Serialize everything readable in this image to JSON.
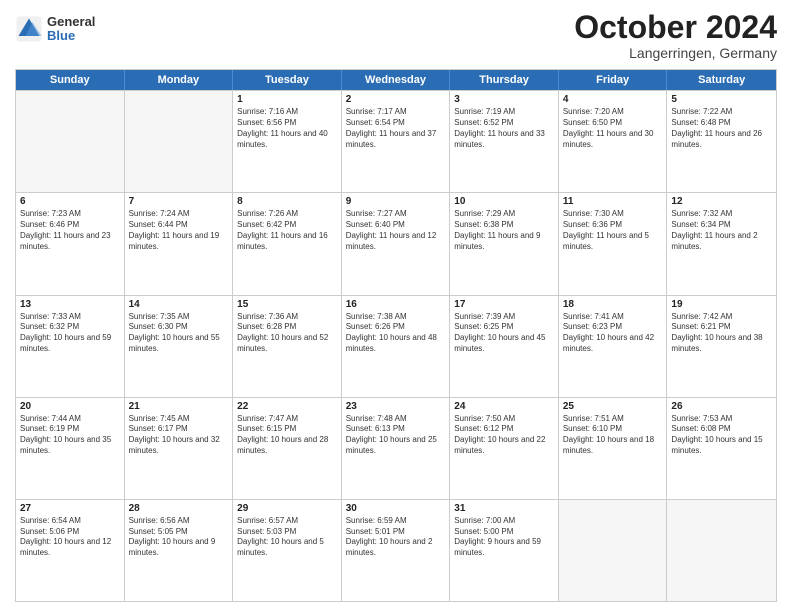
{
  "header": {
    "logo": {
      "general": "General",
      "blue": "Blue"
    },
    "title": "October 2024",
    "location": "Langerringen, Germany"
  },
  "weekdays": [
    "Sunday",
    "Monday",
    "Tuesday",
    "Wednesday",
    "Thursday",
    "Friday",
    "Saturday"
  ],
  "rows": [
    [
      {
        "day": "",
        "info": "",
        "empty": true
      },
      {
        "day": "",
        "info": "",
        "empty": true
      },
      {
        "day": "1",
        "info": "Sunrise: 7:16 AM\nSunset: 6:56 PM\nDaylight: 11 hours and 40 minutes."
      },
      {
        "day": "2",
        "info": "Sunrise: 7:17 AM\nSunset: 6:54 PM\nDaylight: 11 hours and 37 minutes."
      },
      {
        "day": "3",
        "info": "Sunrise: 7:19 AM\nSunset: 6:52 PM\nDaylight: 11 hours and 33 minutes."
      },
      {
        "day": "4",
        "info": "Sunrise: 7:20 AM\nSunset: 6:50 PM\nDaylight: 11 hours and 30 minutes."
      },
      {
        "day": "5",
        "info": "Sunrise: 7:22 AM\nSunset: 6:48 PM\nDaylight: 11 hours and 26 minutes."
      }
    ],
    [
      {
        "day": "6",
        "info": "Sunrise: 7:23 AM\nSunset: 6:46 PM\nDaylight: 11 hours and 23 minutes."
      },
      {
        "day": "7",
        "info": "Sunrise: 7:24 AM\nSunset: 6:44 PM\nDaylight: 11 hours and 19 minutes."
      },
      {
        "day": "8",
        "info": "Sunrise: 7:26 AM\nSunset: 6:42 PM\nDaylight: 11 hours and 16 minutes."
      },
      {
        "day": "9",
        "info": "Sunrise: 7:27 AM\nSunset: 6:40 PM\nDaylight: 11 hours and 12 minutes."
      },
      {
        "day": "10",
        "info": "Sunrise: 7:29 AM\nSunset: 6:38 PM\nDaylight: 11 hours and 9 minutes."
      },
      {
        "day": "11",
        "info": "Sunrise: 7:30 AM\nSunset: 6:36 PM\nDaylight: 11 hours and 5 minutes."
      },
      {
        "day": "12",
        "info": "Sunrise: 7:32 AM\nSunset: 6:34 PM\nDaylight: 11 hours and 2 minutes."
      }
    ],
    [
      {
        "day": "13",
        "info": "Sunrise: 7:33 AM\nSunset: 6:32 PM\nDaylight: 10 hours and 59 minutes."
      },
      {
        "day": "14",
        "info": "Sunrise: 7:35 AM\nSunset: 6:30 PM\nDaylight: 10 hours and 55 minutes."
      },
      {
        "day": "15",
        "info": "Sunrise: 7:36 AM\nSunset: 6:28 PM\nDaylight: 10 hours and 52 minutes."
      },
      {
        "day": "16",
        "info": "Sunrise: 7:38 AM\nSunset: 6:26 PM\nDaylight: 10 hours and 48 minutes."
      },
      {
        "day": "17",
        "info": "Sunrise: 7:39 AM\nSunset: 6:25 PM\nDaylight: 10 hours and 45 minutes."
      },
      {
        "day": "18",
        "info": "Sunrise: 7:41 AM\nSunset: 6:23 PM\nDaylight: 10 hours and 42 minutes."
      },
      {
        "day": "19",
        "info": "Sunrise: 7:42 AM\nSunset: 6:21 PM\nDaylight: 10 hours and 38 minutes."
      }
    ],
    [
      {
        "day": "20",
        "info": "Sunrise: 7:44 AM\nSunset: 6:19 PM\nDaylight: 10 hours and 35 minutes."
      },
      {
        "day": "21",
        "info": "Sunrise: 7:45 AM\nSunset: 6:17 PM\nDaylight: 10 hours and 32 minutes."
      },
      {
        "day": "22",
        "info": "Sunrise: 7:47 AM\nSunset: 6:15 PM\nDaylight: 10 hours and 28 minutes."
      },
      {
        "day": "23",
        "info": "Sunrise: 7:48 AM\nSunset: 6:13 PM\nDaylight: 10 hours and 25 minutes."
      },
      {
        "day": "24",
        "info": "Sunrise: 7:50 AM\nSunset: 6:12 PM\nDaylight: 10 hours and 22 minutes."
      },
      {
        "day": "25",
        "info": "Sunrise: 7:51 AM\nSunset: 6:10 PM\nDaylight: 10 hours and 18 minutes."
      },
      {
        "day": "26",
        "info": "Sunrise: 7:53 AM\nSunset: 6:08 PM\nDaylight: 10 hours and 15 minutes."
      }
    ],
    [
      {
        "day": "27",
        "info": "Sunrise: 6:54 AM\nSunset: 5:06 PM\nDaylight: 10 hours and 12 minutes."
      },
      {
        "day": "28",
        "info": "Sunrise: 6:56 AM\nSunset: 5:05 PM\nDaylight: 10 hours and 9 minutes."
      },
      {
        "day": "29",
        "info": "Sunrise: 6:57 AM\nSunset: 5:03 PM\nDaylight: 10 hours and 5 minutes."
      },
      {
        "day": "30",
        "info": "Sunrise: 6:59 AM\nSunset: 5:01 PM\nDaylight: 10 hours and 2 minutes."
      },
      {
        "day": "31",
        "info": "Sunrise: 7:00 AM\nSunset: 5:00 PM\nDaylight: 9 hours and 59 minutes."
      },
      {
        "day": "",
        "info": "",
        "empty": true
      },
      {
        "day": "",
        "info": "",
        "empty": true
      }
    ]
  ]
}
